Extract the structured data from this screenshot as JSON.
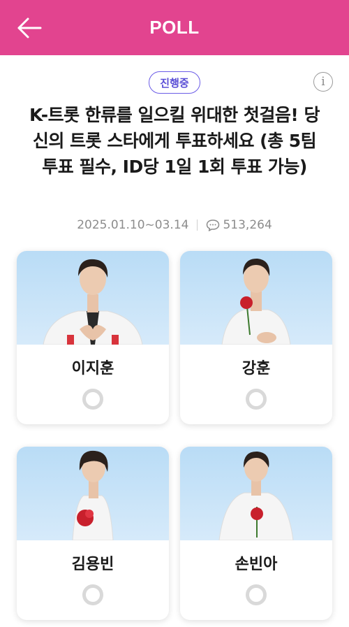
{
  "header": {
    "title": "POLL",
    "back_icon": "arrow-left-icon",
    "bg_color": "#e2448f"
  },
  "poll": {
    "status": "진행중",
    "info_icon": "info-icon",
    "title": "K-트롯 한류를 일으킬 위대한 첫걸음! 당신의 트롯 스타에게 투표하세요 (총 5팀 투표 필수, ID당 1일 1회 투표 가능)",
    "date_range": "2025.01.10~03.14",
    "comment_icon": "comment-icon",
    "vote_count": "513,264"
  },
  "candidates": [
    {
      "name": "이지훈",
      "selected": false
    },
    {
      "name": "강훈",
      "selected": false
    },
    {
      "name": "김용빈",
      "selected": false
    },
    {
      "name": "손빈아",
      "selected": false
    }
  ],
  "colors": {
    "accent": "#e2448f",
    "badge": "#6b5ce7"
  }
}
